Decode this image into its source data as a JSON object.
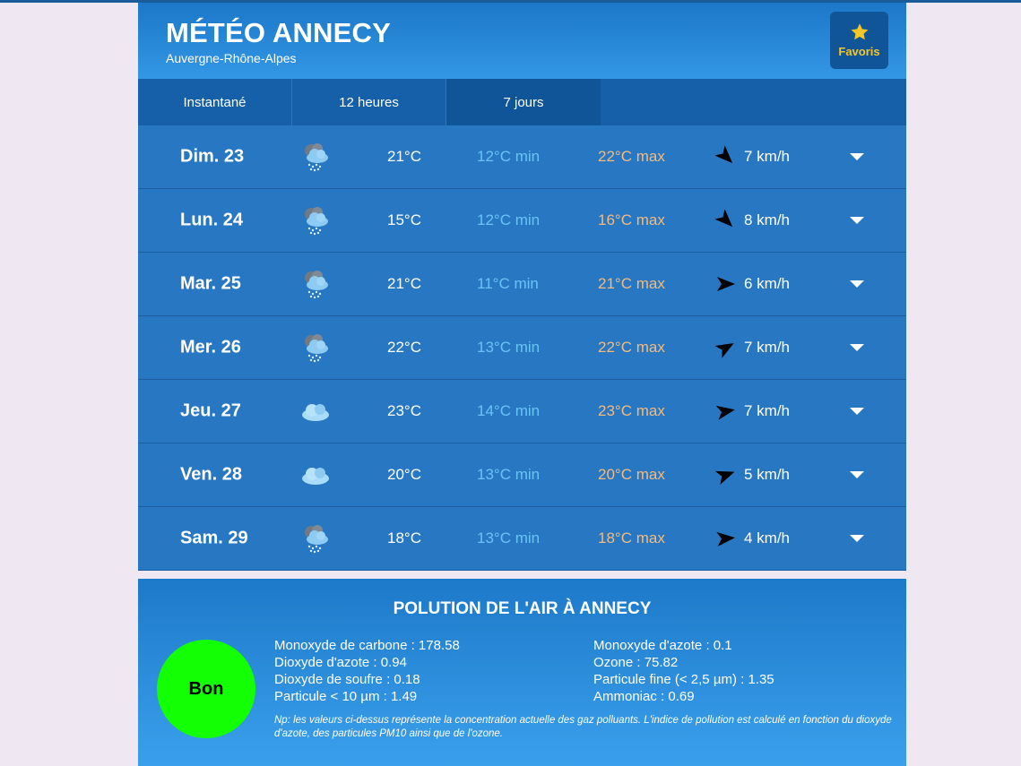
{
  "header": {
    "title": "MÉTÉO ANNECY",
    "subtitle": "Auvergne-Rhône-Alpes",
    "favorites_label": "Favoris"
  },
  "tabs": [
    {
      "label": "Instantané"
    },
    {
      "label": "12 heures"
    },
    {
      "label": "7 jours",
      "active": true
    }
  ],
  "days": [
    {
      "day": "Dim. 23",
      "icon": "cloud-rain-icon",
      "temp": "21°C",
      "min": "12°C min",
      "max": "22°C max",
      "wind_direction_deg": 315,
      "wind": "7 km/h"
    },
    {
      "day": "Lun. 24",
      "icon": "cloud-rain-icon",
      "temp": "15°C",
      "min": "12°C min",
      "max": "16°C max",
      "wind_direction_deg": 315,
      "wind": "8 km/h"
    },
    {
      "day": "Mar. 25",
      "icon": "cloud-rain-icon",
      "temp": "21°C",
      "min": "11°C min",
      "max": "21°C max",
      "wind_direction_deg": 0,
      "wind": "6 km/h"
    },
    {
      "day": "Mer. 26",
      "icon": "cloud-rain-icon",
      "temp": "22°C",
      "min": "13°C min",
      "max": "22°C max",
      "wind_direction_deg": 30,
      "wind": "7 km/h"
    },
    {
      "day": "Jeu. 27",
      "icon": "cloud-icon",
      "temp": "23°C",
      "min": "14°C min",
      "max": "23°C max",
      "wind_direction_deg": 10,
      "wind": "7 km/h"
    },
    {
      "day": "Ven. 28",
      "icon": "cloud-icon",
      "temp": "20°C",
      "min": "13°C min",
      "max": "20°C max",
      "wind_direction_deg": 20,
      "wind": "5 km/h"
    },
    {
      "day": "Sam. 29",
      "icon": "cloud-rain-icon",
      "temp": "18°C",
      "min": "13°C min",
      "max": "18°C max",
      "wind_direction_deg": 5,
      "wind": "4 km/h"
    }
  ],
  "air": {
    "title": "POLUTION DE L'AIR À ANNECY",
    "index_label": "Bon",
    "index_color": "#13ff04",
    "col1": [
      "Monoxyde de carbone : 178.58",
      "Dioxyde d'azote : 0.94",
      "Dioxyde de soufre : 0.18",
      "Particule < 10 µm : 1.49"
    ],
    "col2": [
      "Monoxyde d'azote : 0.1",
      "Ozone : 75.82",
      "Particule fine (< 2,5 µm) : 1.35",
      "Ammoniac : 0.69"
    ],
    "note": "Np: les valeurs ci-dessus représente la concentration actuelle des gaz polluants. L'indice de pollution est calculé en fonction du dioxyde d'azote, des particules PM10 ainsi que de l'ozone."
  },
  "colors": {
    "min_temp": "#69c4f6",
    "max_temp": "#f3bb7d",
    "favorites_star": "#f6c626"
  }
}
